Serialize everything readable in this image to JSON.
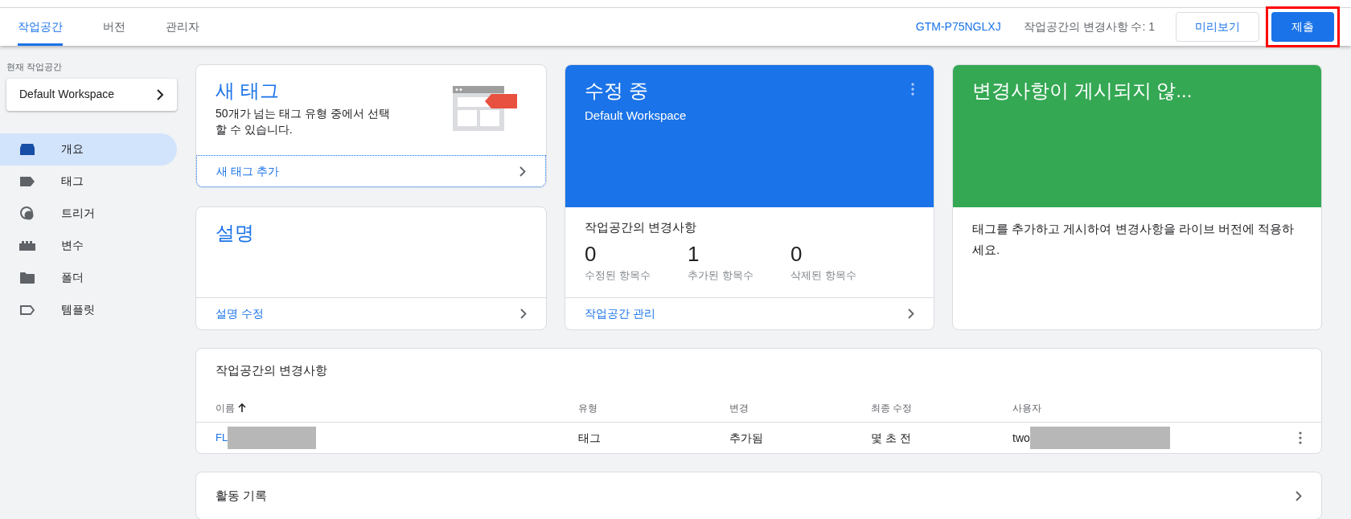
{
  "tabs": [
    {
      "label": "작업공간",
      "selected": true
    },
    {
      "label": "버전",
      "selected": false
    },
    {
      "label": "관리자",
      "selected": false
    }
  ],
  "header": {
    "container_id": "GTM-P75NGLXJ",
    "change_count": "작업공간의 변경사항 수: 1",
    "preview_button": "미리보기",
    "submit_button": {
      "label": "제출",
      "highlighted": true
    }
  },
  "sidebar": {
    "workspace_label": "현재 작업공간",
    "workspace": "Default Workspace",
    "items": [
      {
        "label": "개요",
        "kind": "overview",
        "selected": true
      },
      {
        "label": "태그",
        "kind": "tag",
        "selected": false
      },
      {
        "label": "트리거",
        "kind": "trigger",
        "selected": false
      },
      {
        "label": "변수",
        "kind": "variable",
        "selected": false
      },
      {
        "label": "폴더",
        "kind": "folder",
        "selected": false
      },
      {
        "label": "템플릿",
        "kind": "template",
        "selected": false
      }
    ]
  },
  "new_tag_card": {
    "title": "새 태그",
    "description": "50개가 넘는 태그 유형 중에서 선택할 수 있습니다.",
    "link": "새 태그 추가"
  },
  "description_card": {
    "title": "설명",
    "link": "설명 수정"
  },
  "editing_card": {
    "title": "수정 중",
    "subtitle": "Default Workspace",
    "section_title": "작업공간의 변경사항",
    "stats": [
      {
        "value": "0",
        "label": "수정된 항목수"
      },
      {
        "value": "1",
        "label": "추가된 항목수"
      },
      {
        "value": "0",
        "label": "삭제된 항목수"
      }
    ],
    "link": "작업공간 관리"
  },
  "publish_card": {
    "title": "변경사항이 게시되지 않...",
    "text": "태그를 추가하고 게시하여 변경사항을 라이브 버전에 적용하세요."
  },
  "changes_table": {
    "title": "작업공간의 변경사항",
    "columns": [
      "이름",
      "유형",
      "변경",
      "최종 수정",
      "사용자"
    ],
    "rows": [
      {
        "name": "FL",
        "type": "태그",
        "change": "추가됨",
        "modified": "몇 초 전",
        "user": "two",
        "redacted": true
      }
    ]
  },
  "activity_card": {
    "title": "활동 기록"
  }
}
